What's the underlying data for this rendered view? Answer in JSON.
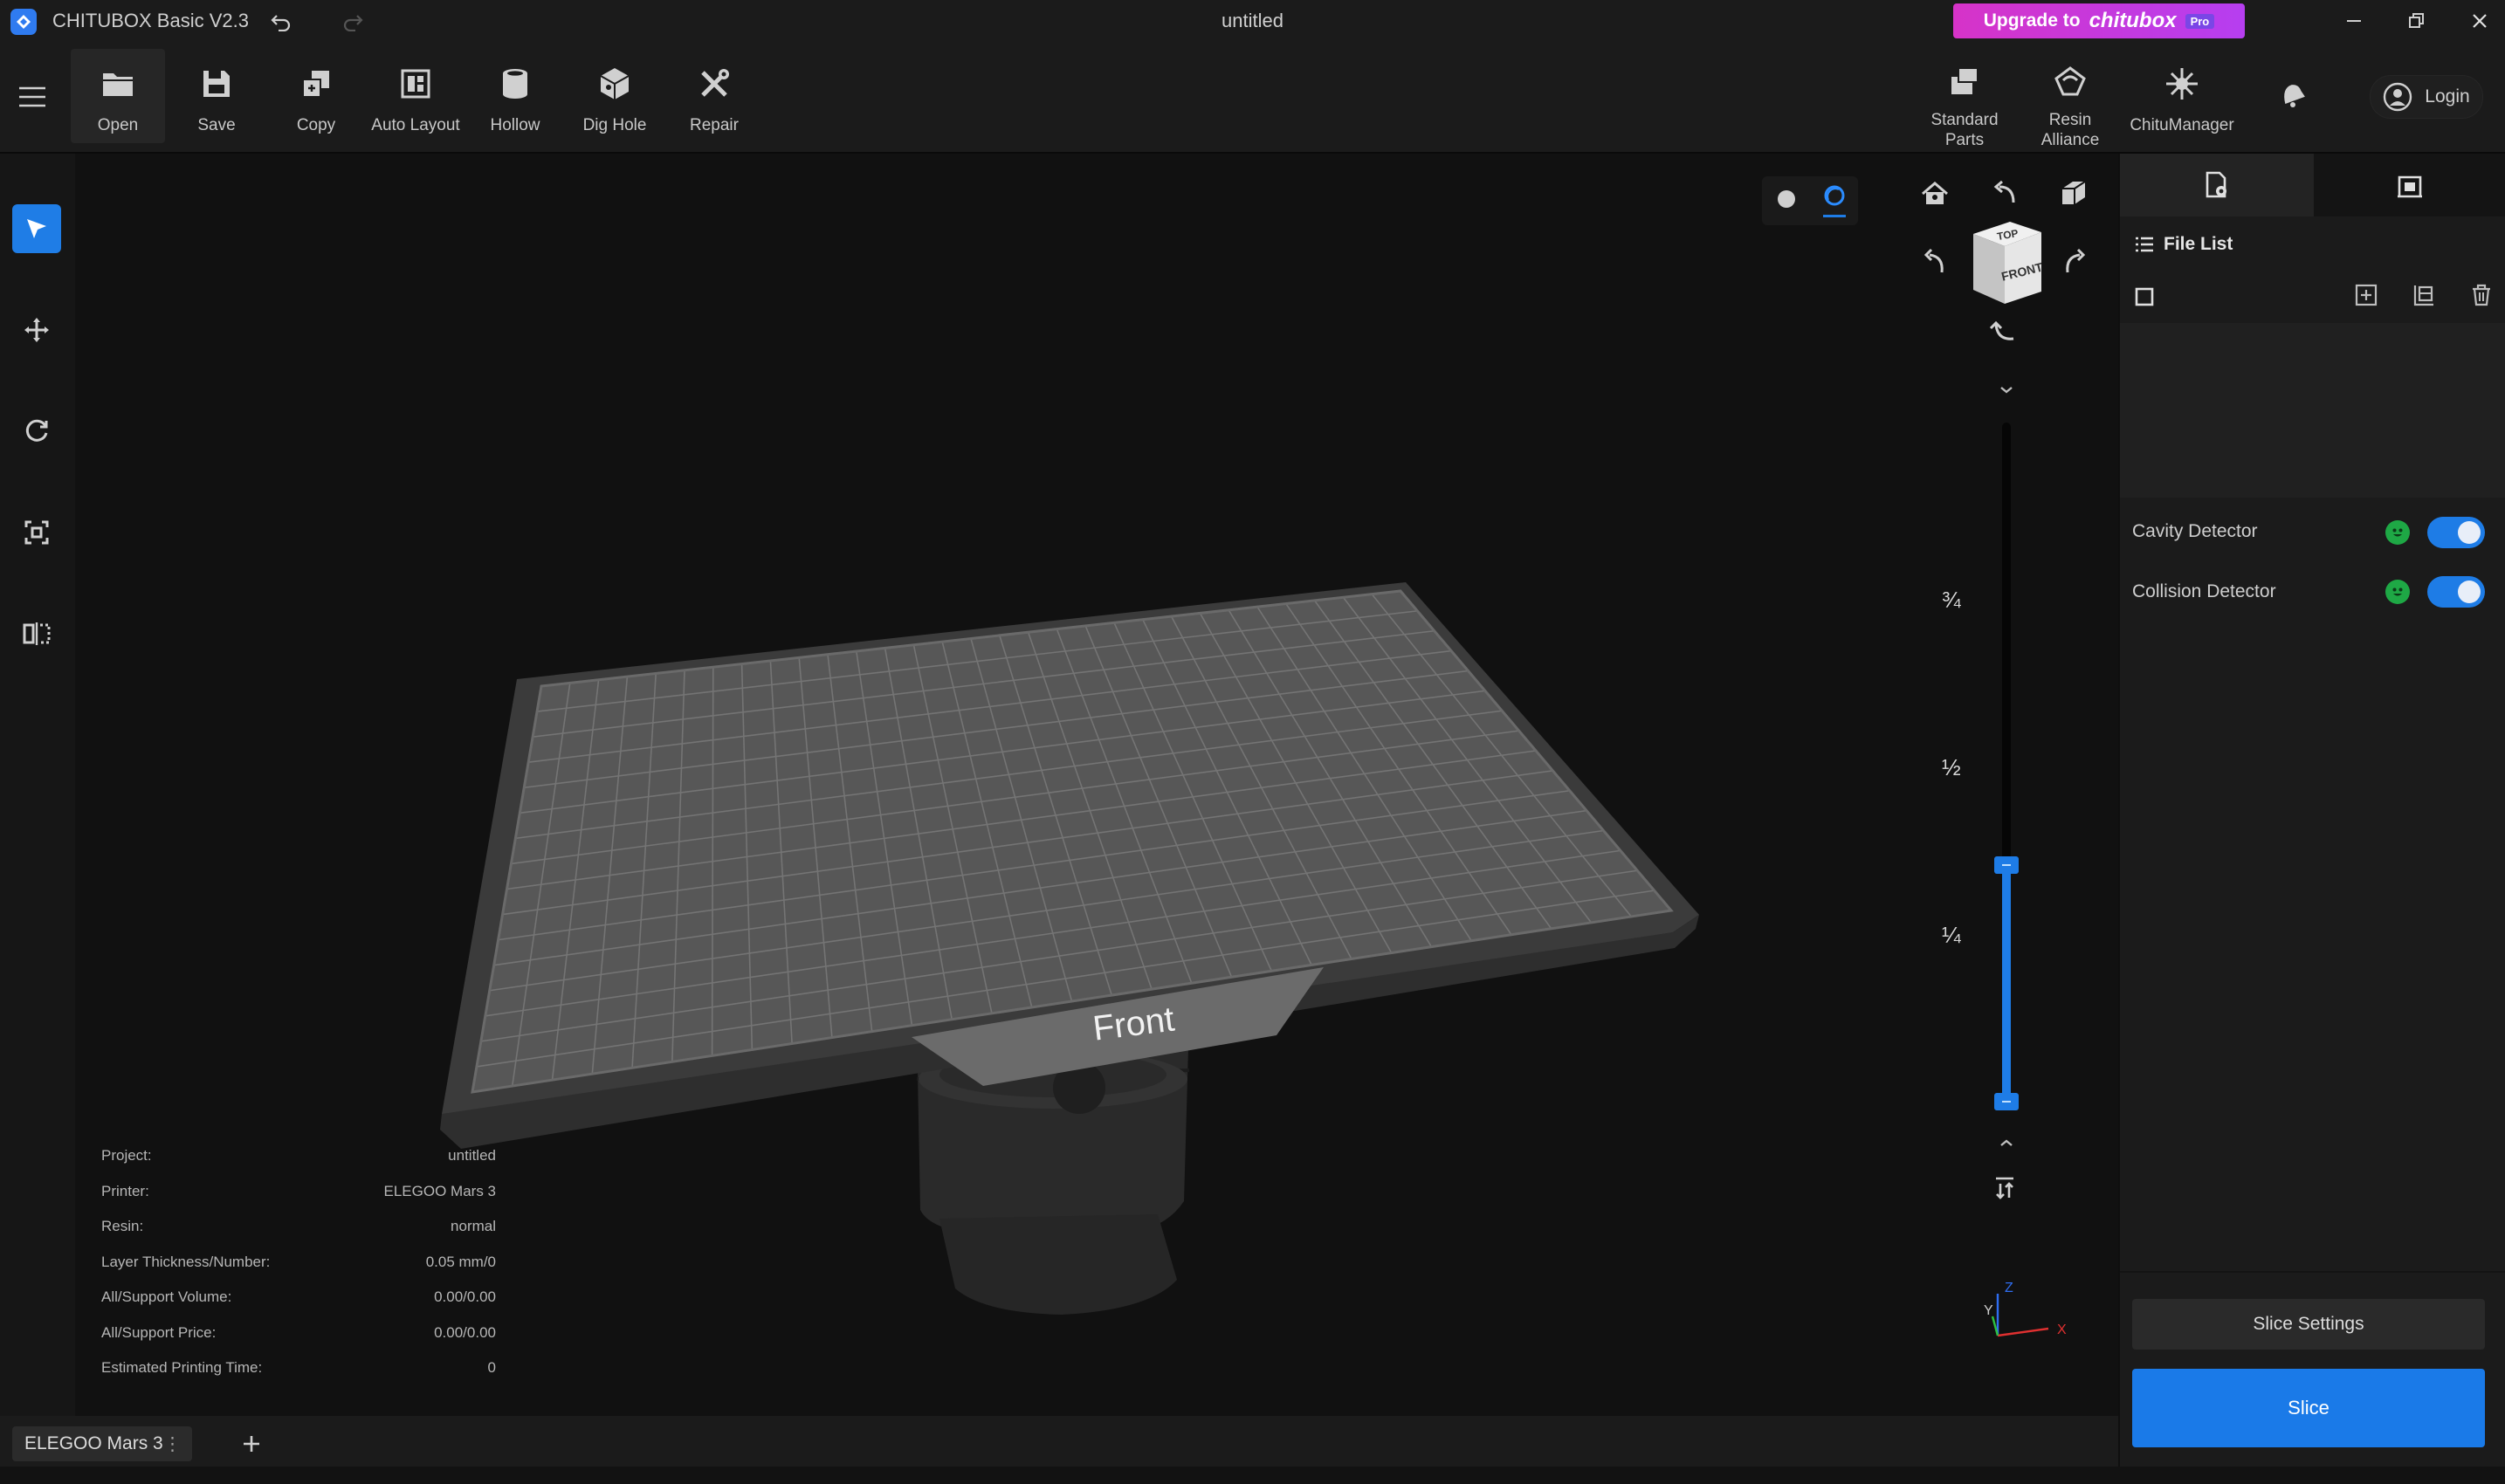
{
  "app": {
    "title": "CHITUBOX Basic V2.3",
    "window_title": "untitled"
  },
  "upgrade": {
    "prefix": "Upgrade to",
    "brand": "chitubox",
    "badge": "Pro"
  },
  "toolbar": {
    "tools": [
      {
        "label": "Open",
        "icon": "folder-icon"
      },
      {
        "label": "Save",
        "icon": "save-icon"
      },
      {
        "label": "Copy",
        "icon": "copy-icon"
      },
      {
        "label": "Auto Layout",
        "icon": "auto-layout-icon"
      },
      {
        "label": "Hollow",
        "icon": "hollow-icon"
      },
      {
        "label": "Dig Hole",
        "icon": "dig-hole-icon"
      },
      {
        "label": "Repair",
        "icon": "repair-icon"
      }
    ],
    "right": [
      {
        "label": "Standard Parts",
        "icon": "standard-parts-icon"
      },
      {
        "label": "Resin Alliance",
        "icon": "resin-alliance-icon"
      },
      {
        "label": "ChituManager",
        "icon": "chitumanager-icon"
      }
    ],
    "login": "Login"
  },
  "viewcube": {
    "top": "TOP",
    "front": "FRONT"
  },
  "plate": {
    "front_label": "Front"
  },
  "slider": {
    "labels": [
      "¾",
      "½",
      "¼"
    ],
    "upper_fraction": 0.35,
    "lower_fraction": 0.0
  },
  "info": {
    "rows": [
      {
        "k": "Project:",
        "v": "untitled"
      },
      {
        "k": "Printer:",
        "v": "ELEGOO Mars 3"
      },
      {
        "k": "Resin:",
        "v": "normal"
      },
      {
        "k": "Layer Thickness/Number:",
        "v": "0.05 mm/0"
      },
      {
        "k": "All/Support Volume:",
        "v": "0.00/0.00"
      },
      {
        "k": "All/Support Price:",
        "v": "0.00/0.00"
      },
      {
        "k": "Estimated Printing Time:",
        "v": "0"
      }
    ]
  },
  "right_panel": {
    "file_list_title": "File List",
    "detectors": [
      {
        "label": "Cavity Detector",
        "enabled": true
      },
      {
        "label": "Collision Detector",
        "enabled": true
      }
    ],
    "slice_settings": "Slice Settings",
    "slice": "Slice"
  },
  "bottom": {
    "printer_tab": "ELEGOO Mars 3",
    "tab_menu": "⋮",
    "add": "+"
  },
  "axes": {
    "x": "X",
    "y": "Y",
    "z": "Z"
  },
  "colors": {
    "accent": "#1e7ce6",
    "upgrade_start": "#d633c8",
    "upgrade_end": "#b63ef0",
    "ok_green": "#1ea845"
  }
}
